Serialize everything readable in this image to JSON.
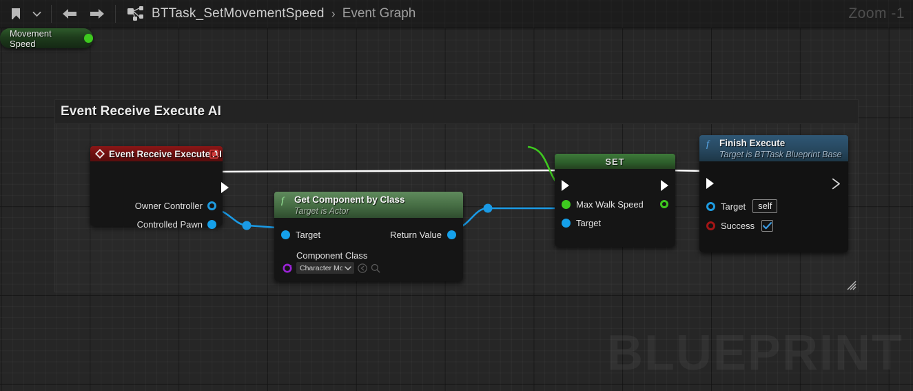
{
  "toolbar": {
    "bookmark_icon": "bookmark-icon",
    "dropdown_icon": "chevron-down-icon",
    "back_icon": "arrow-left-icon",
    "forward_icon": "arrow-right-icon",
    "graph_icon": "blueprint-graph-icon",
    "breadcrumb_root": "BTTask_SetMovementSpeed",
    "breadcrumb_sep": "›",
    "breadcrumb_current": "Event Graph",
    "zoom_label": "Zoom -1"
  },
  "canvas": {
    "watermark": "BLUEPRINT",
    "comment": {
      "title": "Event Receive Execute AI"
    }
  },
  "nodes": {
    "event_receive": {
      "title": "Event Receive Execute AI",
      "icon": "event-diamond-icon",
      "delegate_icon": "delegate-pin-icon",
      "exec_out": "exec-output-pin",
      "pins": [
        {
          "label": "Owner Controller",
          "type": "object",
          "color": "#1e9be0"
        },
        {
          "label": "Controlled Pawn",
          "type": "object",
          "color": "#15a0ea"
        }
      ]
    },
    "get_component_by_class": {
      "icon": "function-f-icon",
      "title": "Get Component by Class",
      "subtitle": "Target is Actor",
      "pins_in": [
        {
          "label": "Target",
          "type": "object",
          "color": "#15a0ea"
        }
      ],
      "pins_out": [
        {
          "label": "Return Value",
          "type": "object",
          "color": "#15a0ea"
        }
      ],
      "component_class_label": "Component Class",
      "component_class_value": "Character Movem",
      "component_class_pin_color": "#9a23d6",
      "reset_icon": "reset-arrow-icon",
      "browse_icon": "search-icon",
      "dropdown_icon": "chevron-down-icon"
    },
    "set_node": {
      "title": "SET",
      "exec_in": "exec-input-pin",
      "exec_out": "exec-output-pin",
      "pins": [
        {
          "label": "Max Walk Speed",
          "type": "float",
          "color": "#3ec91f"
        },
        {
          "label": "Target",
          "type": "object",
          "color": "#15a0ea"
        }
      ],
      "out_pin": {
        "label": "",
        "type": "float",
        "color": "#3ec91f"
      }
    },
    "finish_execute": {
      "icon": "function-f-icon",
      "title": "Finish Execute",
      "subtitle": "Target is BTTask Blueprint Base",
      "exec_in": "exec-input-pin",
      "exec_out": "exec-output-pin",
      "pins": [
        {
          "label": "Target",
          "type": "object",
          "color": "#1e9be0",
          "value": "self",
          "widget": "text"
        },
        {
          "label": "Success",
          "type": "boolean",
          "color": "#a41616",
          "value": "true",
          "widget": "checkbox"
        }
      ]
    },
    "movement_speed_var": {
      "label": "Movement Speed",
      "pin_color": "#3ec91f"
    }
  },
  "colors": {
    "exec_wire": "#ffffff",
    "object_wire": "#1a9ae5",
    "float_wire": "#3ec91f",
    "canvas_bg": "#262626",
    "comment_bg": "#232323"
  }
}
